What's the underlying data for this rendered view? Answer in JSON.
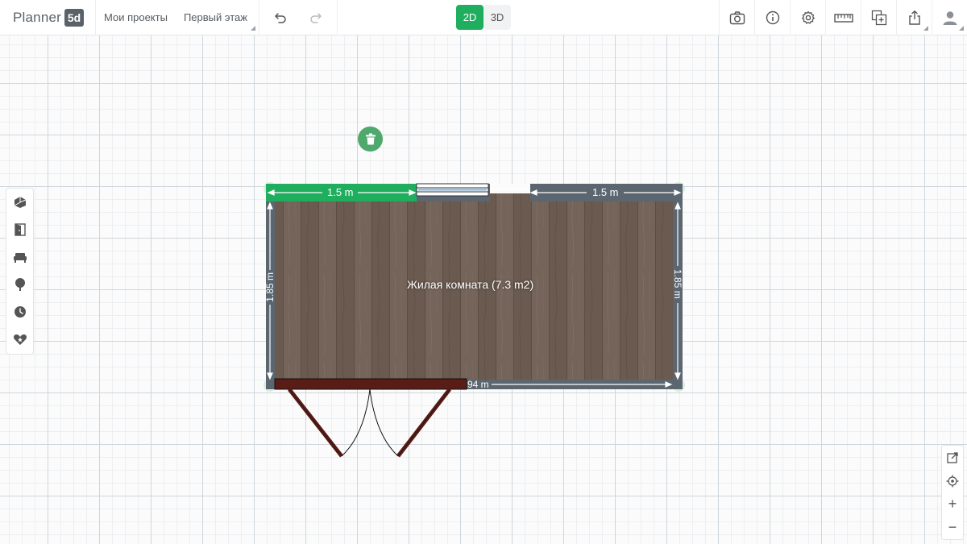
{
  "app": {
    "logo_text": "Planner",
    "logo_badge": "5d"
  },
  "menu": {
    "projects": "Мои проекты",
    "floor": "Первый этаж"
  },
  "view_modes": {
    "mode_2d": "2D",
    "mode_3d": "3D",
    "active": "2D"
  },
  "toolbar_right": [
    "camera-icon",
    "info-icon",
    "settings-icon",
    "ruler-icon",
    "add-object-icon",
    "share-icon",
    "user-icon"
  ],
  "left_toolbar": [
    "construction-icon",
    "door-icon",
    "furniture-icon",
    "exterior-icon",
    "history-icon",
    "favorites-icon"
  ],
  "zoom": {
    "zoom_in": "+",
    "zoom_out": "−"
  },
  "plan": {
    "room_label": "Жилая комната (7.3 m2)",
    "dim_top_left": "1.5 m",
    "dim_top_right": "1.5 m",
    "dim_left": "1.85 m",
    "dim_right": "1.85 m",
    "dim_bottom": "94 m"
  },
  "colors": {
    "accent": "#1fae5e",
    "wall": "#5b6670",
    "floor": "#6f5e52",
    "door": "#5a1c16"
  }
}
